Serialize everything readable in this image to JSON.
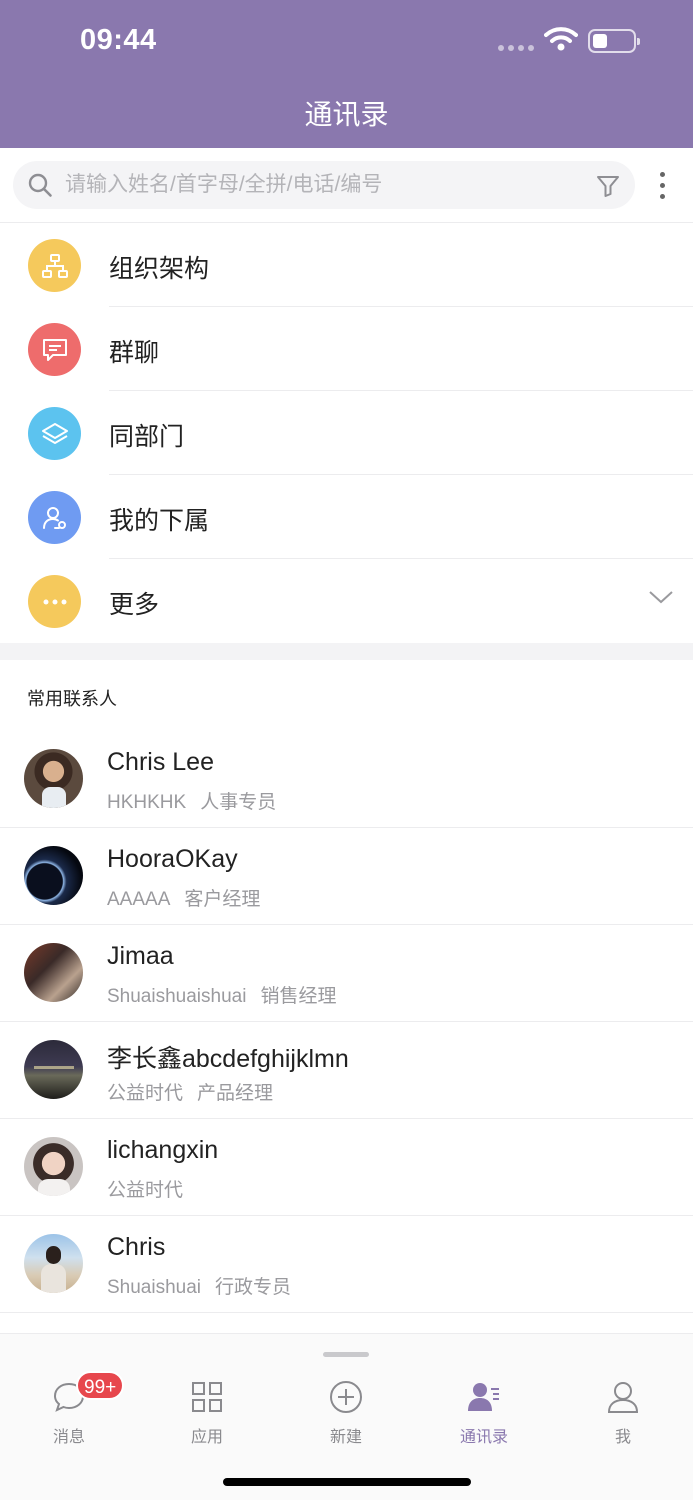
{
  "status_bar": {
    "time": "09:44"
  },
  "header": {
    "title": "通讯录"
  },
  "search": {
    "placeholder": "请输入姓名/首字母/全拼/电话/编号",
    "value": ""
  },
  "menu": [
    {
      "label": "组织架构",
      "icon": "org-chart-icon",
      "color": "#f5c95c"
    },
    {
      "label": "群聊",
      "icon": "chat-bubble-icon",
      "color": "#ee6c6c"
    },
    {
      "label": "同部门",
      "icon": "layers-icon",
      "color": "#5cc3ef"
    },
    {
      "label": "我的下属",
      "icon": "subordinate-icon",
      "color": "#6f9bf2"
    },
    {
      "label": "更多",
      "icon": "ellipsis-icon",
      "color": "#f5c95c"
    }
  ],
  "frequent_contacts": {
    "title": "常用联系人",
    "items": [
      {
        "name": "Chris Lee",
        "org": "HKHKHK",
        "role": "人事专员"
      },
      {
        "name": "HooraOKay",
        "org": "AAAAA",
        "role": "客户经理"
      },
      {
        "name": "Jimaa",
        "org": "Shuaishuaishuai",
        "role": "销售经理"
      },
      {
        "name": "李长鑫abcdefghijklmn",
        "org": "公益时代",
        "role": "产品经理"
      },
      {
        "name": "lichangxin",
        "org": "公益时代",
        "role": ""
      },
      {
        "name": "Chris",
        "org": "Shuaishuai",
        "role": "行政专员"
      }
    ]
  },
  "tabbar": {
    "tabs": [
      {
        "label": "消息",
        "icon": "message-icon",
        "badge": "99+"
      },
      {
        "label": "应用",
        "icon": "apps-grid-icon"
      },
      {
        "label": "新建",
        "icon": "plus-circle-icon"
      },
      {
        "label": "通讯录",
        "icon": "contacts-icon",
        "active": true
      },
      {
        "label": "我",
        "icon": "person-icon"
      }
    ]
  },
  "colors": {
    "primary": "#8a78ae",
    "badge": "#e7474d"
  }
}
